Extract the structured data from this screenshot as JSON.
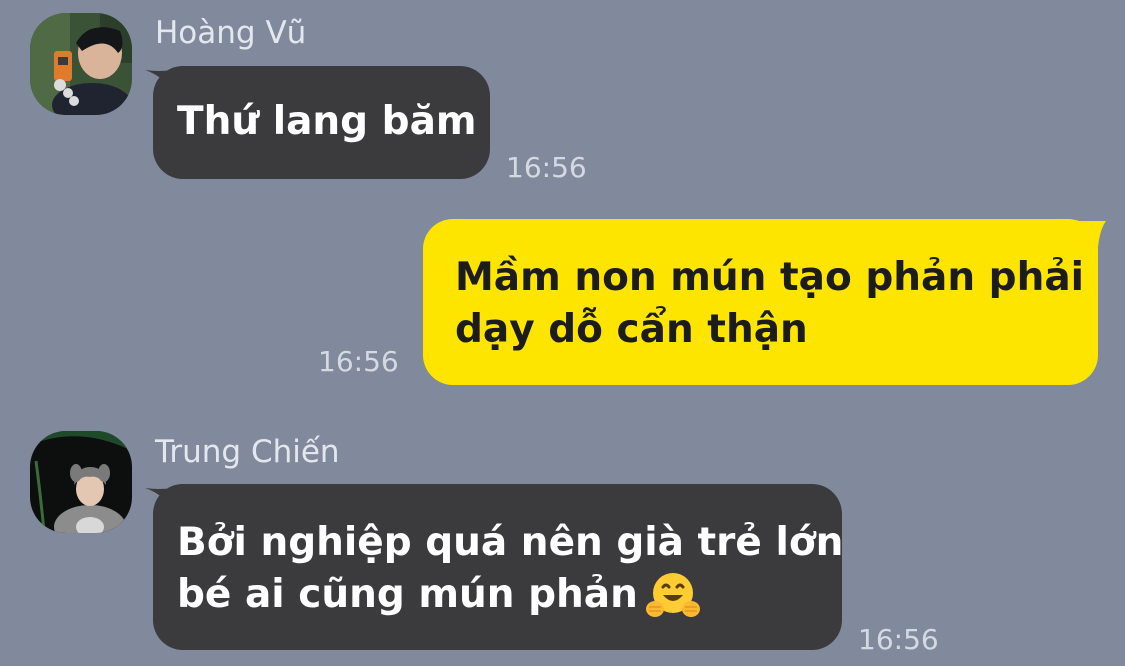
{
  "messages": [
    {
      "direction": "incoming",
      "sender": "Hoàng Vũ",
      "lines": [
        "Thứ lang băm"
      ],
      "time": "16:56"
    },
    {
      "direction": "outgoing",
      "lines": [
        "Mầm non mún tạo phản phải",
        "dạy dỗ cẩn thận"
      ],
      "time": "16:56"
    },
    {
      "direction": "incoming",
      "sender": "Trung Chiến",
      "lines": [
        "Bởi nghiệp quá nên già trẻ lớn",
        "bé ai cũng mún phản"
      ],
      "emoji": "hugging-face-emoji",
      "time": "16:56"
    }
  ],
  "colors": {
    "background": "#808a9c",
    "incoming_bubble": "#3b3b3e",
    "outgoing_bubble": "#fee500"
  }
}
